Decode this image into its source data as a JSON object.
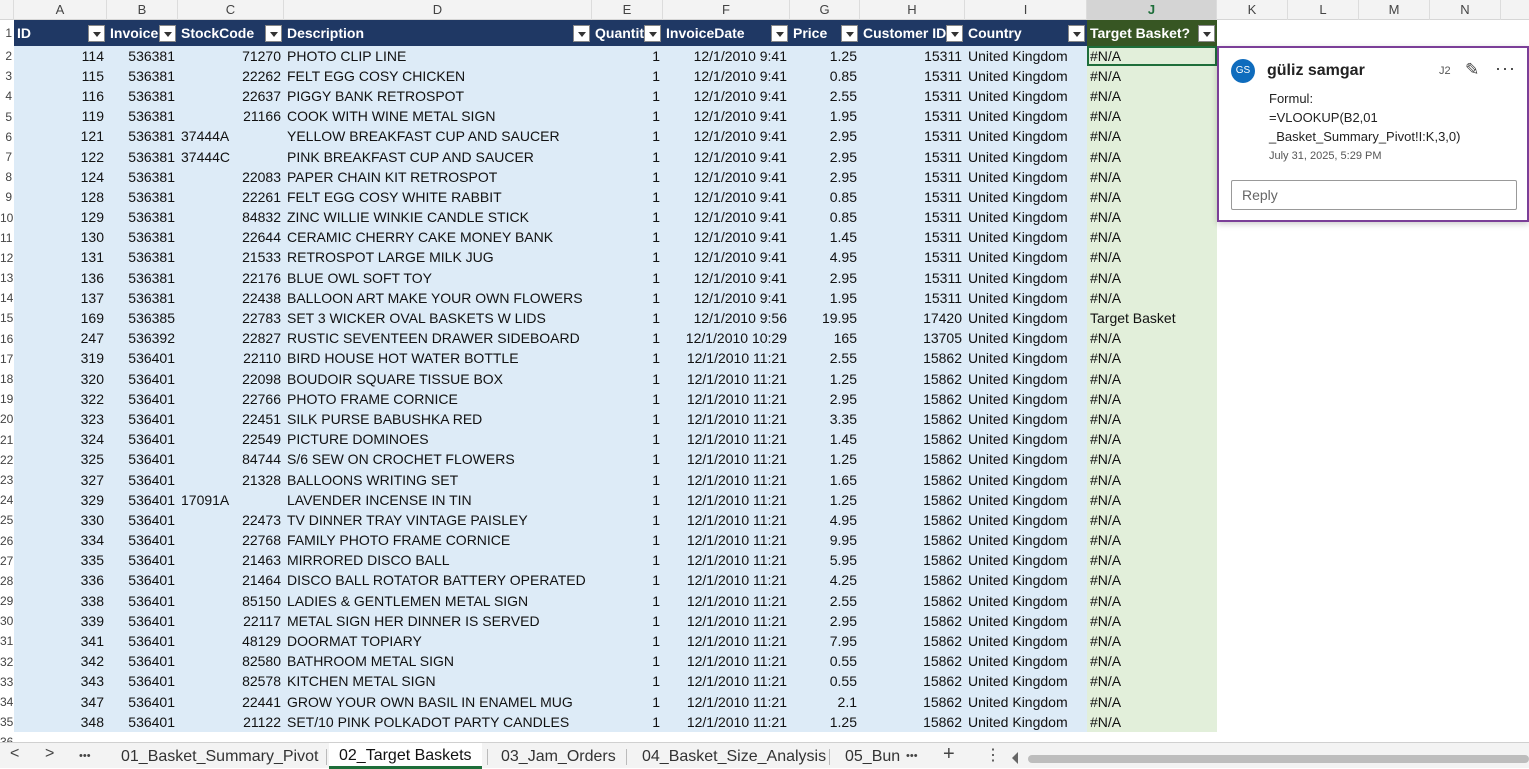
{
  "columns": [
    "A",
    "B",
    "C",
    "D",
    "E",
    "F",
    "G",
    "H",
    "I",
    "J",
    "K",
    "L",
    "M",
    "N"
  ],
  "selected_column": "J",
  "headers": [
    "ID",
    "Invoice",
    "StockCode",
    "Description",
    "Quantit",
    "InvoiceDate",
    "Price",
    "Customer ID",
    "Country",
    "Target Basket?"
  ],
  "row_numbers": [
    "1",
    "2",
    "3",
    "4",
    "5",
    "6",
    "7",
    "8",
    "9",
    "10",
    "11",
    "12",
    "13",
    "14",
    "15",
    "16",
    "17",
    "18",
    "19",
    "20",
    "21",
    "22",
    "23",
    "24",
    "25",
    "26",
    "27",
    "28",
    "29",
    "30",
    "31",
    "32",
    "33",
    "34",
    "35",
    "36"
  ],
  "rows": [
    [
      "114",
      "536381",
      "71270",
      "PHOTO CLIP LINE",
      "1",
      "12/1/2010 9:41",
      "1.25",
      "15311",
      "United Kingdom",
      "#N/A"
    ],
    [
      "115",
      "536381",
      "22262",
      "FELT EGG COSY CHICKEN",
      "1",
      "12/1/2010 9:41",
      "0.85",
      "15311",
      "United Kingdom",
      "#N/A"
    ],
    [
      "116",
      "536381",
      "22637",
      "PIGGY BANK RETROSPOT",
      "1",
      "12/1/2010 9:41",
      "2.55",
      "15311",
      "United Kingdom",
      "#N/A"
    ],
    [
      "119",
      "536381",
      "21166",
      "COOK WITH WINE METAL SIGN",
      "1",
      "12/1/2010 9:41",
      "1.95",
      "15311",
      "United Kingdom",
      "#N/A"
    ],
    [
      "121",
      "536381",
      "37444A",
      "YELLOW BREAKFAST CUP AND SAUCER",
      "1",
      "12/1/2010 9:41",
      "2.95",
      "15311",
      "United Kingdom",
      "#N/A"
    ],
    [
      "122",
      "536381",
      "37444C",
      "PINK BREAKFAST CUP AND SAUCER",
      "1",
      "12/1/2010 9:41",
      "2.95",
      "15311",
      "United Kingdom",
      "#N/A"
    ],
    [
      "124",
      "536381",
      "22083",
      "PAPER CHAIN KIT RETROSPOT",
      "1",
      "12/1/2010 9:41",
      "2.95",
      "15311",
      "United Kingdom",
      "#N/A"
    ],
    [
      "128",
      "536381",
      "22261",
      "FELT EGG COSY WHITE RABBIT",
      "1",
      "12/1/2010 9:41",
      "0.85",
      "15311",
      "United Kingdom",
      "#N/A"
    ],
    [
      "129",
      "536381",
      "84832",
      "ZINC WILLIE WINKIE  CANDLE STICK",
      "1",
      "12/1/2010 9:41",
      "0.85",
      "15311",
      "United Kingdom",
      "#N/A"
    ],
    [
      "130",
      "536381",
      "22644",
      "CERAMIC CHERRY CAKE MONEY BANK",
      "1",
      "12/1/2010 9:41",
      "1.45",
      "15311",
      "United Kingdom",
      "#N/A"
    ],
    [
      "131",
      "536381",
      "21533",
      "RETROSPOT LARGE MILK JUG",
      "1",
      "12/1/2010 9:41",
      "4.95",
      "15311",
      "United Kingdom",
      "#N/A"
    ],
    [
      "136",
      "536381",
      "22176",
      "BLUE OWL SOFT TOY",
      "1",
      "12/1/2010 9:41",
      "2.95",
      "15311",
      "United Kingdom",
      "#N/A"
    ],
    [
      "137",
      "536381",
      "22438",
      "BALLOON ART MAKE YOUR OWN FLOWERS",
      "1",
      "12/1/2010 9:41",
      "1.95",
      "15311",
      "United Kingdom",
      "#N/A"
    ],
    [
      "169",
      "536385",
      "22783",
      "SET 3 WICKER OVAL BASKETS W LIDS",
      "1",
      "12/1/2010 9:56",
      "19.95",
      "17420",
      "United Kingdom",
      "Target Basket"
    ],
    [
      "247",
      "536392",
      "22827",
      "RUSTIC  SEVENTEEN DRAWER SIDEBOARD",
      "1",
      "12/1/2010 10:29",
      "165",
      "13705",
      "United Kingdom",
      "#N/A"
    ],
    [
      "319",
      "536401",
      "22110",
      "BIRD HOUSE HOT WATER BOTTLE",
      "1",
      "12/1/2010 11:21",
      "2.55",
      "15862",
      "United Kingdom",
      "#N/A"
    ],
    [
      "320",
      "536401",
      "22098",
      "BOUDOIR SQUARE TISSUE BOX",
      "1",
      "12/1/2010 11:21",
      "1.25",
      "15862",
      "United Kingdom",
      "#N/A"
    ],
    [
      "322",
      "536401",
      "22766",
      "PHOTO FRAME CORNICE",
      "1",
      "12/1/2010 11:21",
      "2.95",
      "15862",
      "United Kingdom",
      "#N/A"
    ],
    [
      "323",
      "536401",
      "22451",
      "SILK PURSE BABUSHKA RED",
      "1",
      "12/1/2010 11:21",
      "3.35",
      "15862",
      "United Kingdom",
      "#N/A"
    ],
    [
      "324",
      "536401",
      "22549",
      "PICTURE DOMINOES",
      "1",
      "12/1/2010 11:21",
      "1.45",
      "15862",
      "United Kingdom",
      "#N/A"
    ],
    [
      "325",
      "536401",
      "84744",
      "S/6 SEW ON CROCHET FLOWERS",
      "1",
      "12/1/2010 11:21",
      "1.25",
      "15862",
      "United Kingdom",
      "#N/A"
    ],
    [
      "327",
      "536401",
      "21328",
      "BALLOONS  WRITING SET",
      "1",
      "12/1/2010 11:21",
      "1.65",
      "15862",
      "United Kingdom",
      "#N/A"
    ],
    [
      "329",
      "536401",
      "17091A",
      "LAVENDER INCENSE IN TIN",
      "1",
      "12/1/2010 11:21",
      "1.25",
      "15862",
      "United Kingdom",
      "#N/A"
    ],
    [
      "330",
      "536401",
      "22473",
      "TV DINNER TRAY VINTAGE PAISLEY",
      "1",
      "12/1/2010 11:21",
      "4.95",
      "15862",
      "United Kingdom",
      "#N/A"
    ],
    [
      "334",
      "536401",
      "22768",
      "FAMILY PHOTO FRAME CORNICE",
      "1",
      "12/1/2010 11:21",
      "9.95",
      "15862",
      "United Kingdom",
      "#N/A"
    ],
    [
      "335",
      "536401",
      "21463",
      "MIRRORED DISCO BALL",
      "1",
      "12/1/2010 11:21",
      "5.95",
      "15862",
      "United Kingdom",
      "#N/A"
    ],
    [
      "336",
      "536401",
      "21464",
      "DISCO BALL ROTATOR BATTERY OPERATED",
      "1",
      "12/1/2010 11:21",
      "4.25",
      "15862",
      "United Kingdom",
      "#N/A"
    ],
    [
      "338",
      "536401",
      "85150",
      "LADIES & GENTLEMEN METAL SIGN",
      "1",
      "12/1/2010 11:21",
      "2.55",
      "15862",
      "United Kingdom",
      "#N/A"
    ],
    [
      "339",
      "536401",
      "22117",
      "METAL SIGN HER DINNER IS SERVED",
      "1",
      "12/1/2010 11:21",
      "2.95",
      "15862",
      "United Kingdom",
      "#N/A"
    ],
    [
      "341",
      "536401",
      "48129",
      "DOORMAT TOPIARY",
      "1",
      "12/1/2010 11:21",
      "7.95",
      "15862",
      "United Kingdom",
      "#N/A"
    ],
    [
      "342",
      "536401",
      "82580",
      "BATHROOM METAL SIGN",
      "1",
      "12/1/2010 11:21",
      "0.55",
      "15862",
      "United Kingdom",
      "#N/A"
    ],
    [
      "343",
      "536401",
      "82578",
      "KITCHEN METAL SIGN",
      "1",
      "12/1/2010 11:21",
      "0.55",
      "15862",
      "United Kingdom",
      "#N/A"
    ],
    [
      "347",
      "536401",
      "22441",
      "GROW YOUR OWN BASIL IN ENAMEL MUG",
      "1",
      "12/1/2010 11:21",
      "2.1",
      "15862",
      "United Kingdom",
      "#N/A"
    ],
    [
      "348",
      "536401",
      "21122",
      "SET/10 PINK POLKADOT PARTY CANDLES",
      "1",
      "12/1/2010 11:21",
      "1.25",
      "15862",
      "United Kingdom",
      "#N/A"
    ]
  ],
  "comment": {
    "initials": "GS",
    "author": "güliz samgar",
    "cell_ref": "J2",
    "body_line1": "Formul:",
    "body_line2": "=VLOOKUP(B2,01",
    "body_line3": "_Basket_Summary_Pivot!I:K,3,0)",
    "date": "July 31, 2025, 5:29 PM",
    "reply_placeholder": "Reply"
  },
  "tabs": {
    "prev": "<",
    "next": ">",
    "more_left": "•••",
    "tab1": "01_Basket_Summary_Pivot",
    "tab2": "02_Target Baskets",
    "tab3": "03_Jam_Orders",
    "tab4": "04_Basket_Size_Analysis",
    "tab5": "05_Bun",
    "more_right": "•••",
    "add": "+",
    "menu": "⋮"
  },
  "colors": {
    "header_fill": "#1f3864",
    "target_header_fill": "#375623",
    "data_fill": "#ddebf7",
    "target_fill": "#e2efda",
    "comment_border": "#7b3f98"
  },
  "icons": [
    "dropdown-arrow-icon",
    "edit-pencil-icon",
    "more-options-icon",
    "scroll-left-icon"
  ]
}
